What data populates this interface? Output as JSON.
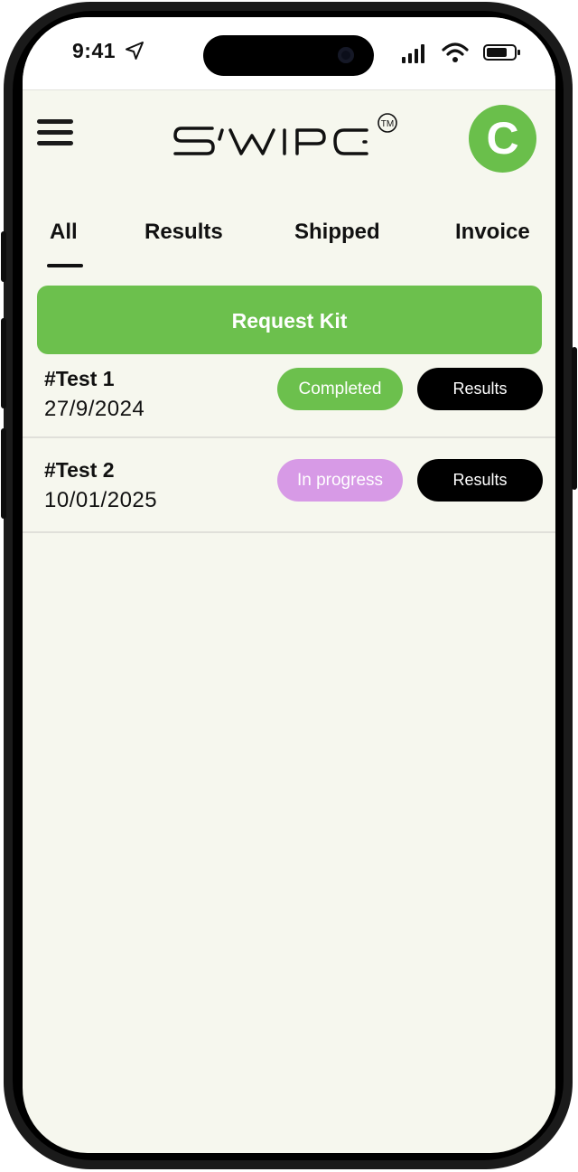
{
  "status_bar": {
    "time": "9:41"
  },
  "header": {
    "logo_text": "S'WIPC",
    "logo_mark": "TM",
    "avatar_initial": "C"
  },
  "tabs": [
    {
      "label": "All",
      "active": true
    },
    {
      "label": "Results",
      "active": false
    },
    {
      "label": "Shipped",
      "active": false
    },
    {
      "label": "Invoice",
      "active": false
    }
  ],
  "request_button": {
    "label": "Request Kit"
  },
  "tests": [
    {
      "name": "#Test 1",
      "date": "27/9/2024",
      "status": "Completed",
      "status_color": "#6cc04d",
      "action_label": "Results"
    },
    {
      "name": "#Test 2",
      "date": "10/01/2025",
      "status": "In progress",
      "status_color": "#d79ae6",
      "action_label": "Results"
    }
  ],
  "colors": {
    "accent_green": "#6cc04d",
    "background": "#f6f7ee",
    "in_progress": "#d79ae6",
    "dark": "#000000"
  },
  "icons": [
    "location-arrow-icon",
    "cellular-signal-icon",
    "wifi-icon",
    "battery-icon",
    "menu-icon"
  ]
}
